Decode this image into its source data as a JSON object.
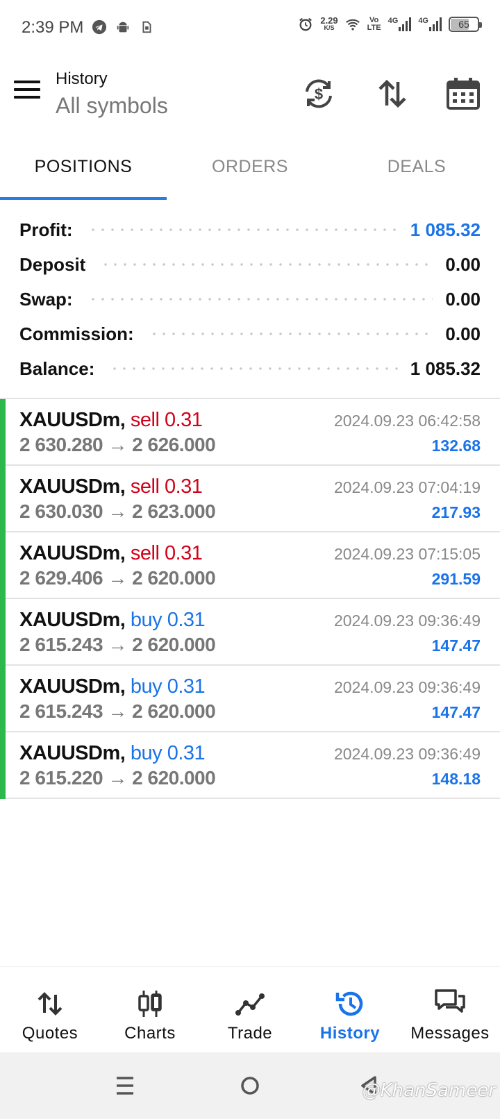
{
  "status_bar": {
    "time": "2:39 PM",
    "net_speed_value": "2.29",
    "net_speed_unit": "K/S",
    "volte_top": "Vo",
    "volte_bottom": "LTE",
    "sim1_type": "4G",
    "sim2_type": "4G",
    "battery_level": "65",
    "icons": [
      "telegram-icon",
      "android-icon",
      "sim-icon",
      "alarm-icon",
      "wifi-icon",
      "signal-icon",
      "battery-icon"
    ]
  },
  "header": {
    "title": "History",
    "subtitle": "All symbols",
    "actions": [
      "currency-refresh-icon",
      "sort-icon",
      "calendar-icon"
    ]
  },
  "tabs": [
    {
      "label": "POSITIONS",
      "active": true
    },
    {
      "label": "ORDERS",
      "active": false
    },
    {
      "label": "DEALS",
      "active": false
    }
  ],
  "summary": [
    {
      "label": "Profit:",
      "value": "1 085.32",
      "highlight": true
    },
    {
      "label": "Deposit",
      "value": "0.00",
      "highlight": false
    },
    {
      "label": "Swap:",
      "value": "0.00",
      "highlight": false
    },
    {
      "label": "Commission:",
      "value": "0.00",
      "highlight": false
    },
    {
      "label": "Balance:",
      "value": "1 085.32",
      "highlight": false
    }
  ],
  "positions": [
    {
      "symbol": "XAUUSDm,",
      "side": "sell 0.31",
      "type": "sell",
      "open": "2 630.280",
      "arrow": "→",
      "close": "2 626.000",
      "time": "2024.09.23 06:42:58",
      "profit": "132.68"
    },
    {
      "symbol": "XAUUSDm,",
      "side": "sell 0.31",
      "type": "sell",
      "open": "2 630.030",
      "arrow": "→",
      "close": "2 623.000",
      "time": "2024.09.23 07:04:19",
      "profit": "217.93"
    },
    {
      "symbol": "XAUUSDm,",
      "side": "sell 0.31",
      "type": "sell",
      "open": "2 629.406",
      "arrow": "→",
      "close": "2 620.000",
      "time": "2024.09.23 07:15:05",
      "profit": "291.59"
    },
    {
      "symbol": "XAUUSDm,",
      "side": "buy 0.31",
      "type": "buy",
      "open": "2 615.243",
      "arrow": "→",
      "close": "2 620.000",
      "time": "2024.09.23 09:36:49",
      "profit": "147.47"
    },
    {
      "symbol": "XAUUSDm,",
      "side": "buy 0.31",
      "type": "buy",
      "open": "2 615.243",
      "arrow": "→",
      "close": "2 620.000",
      "time": "2024.09.23 09:36:49",
      "profit": "147.47"
    },
    {
      "symbol": "XAUUSDm,",
      "side": "buy 0.31",
      "type": "buy",
      "open": "2 615.220",
      "arrow": "→",
      "close": "2 620.000",
      "time": "2024.09.23 09:36:49",
      "profit": "148.18"
    }
  ],
  "bottom_nav": [
    {
      "label": "Quotes",
      "icon": "quotes-icon",
      "active": false
    },
    {
      "label": "Charts",
      "icon": "charts-icon",
      "active": false
    },
    {
      "label": "Trade",
      "icon": "trade-icon",
      "active": false
    },
    {
      "label": "History",
      "icon": "history-icon",
      "active": true
    },
    {
      "label": "Messages",
      "icon": "messages-icon",
      "active": false
    }
  ],
  "system_nav": [
    "recents-icon",
    "home-icon",
    "back-icon"
  ],
  "watermark": "@KhanSameer",
  "colors": {
    "accent": "#1a73e8",
    "sell": "#d0021b",
    "position_bar": "#2db84d",
    "tab_indicator": "#2a7be4"
  }
}
